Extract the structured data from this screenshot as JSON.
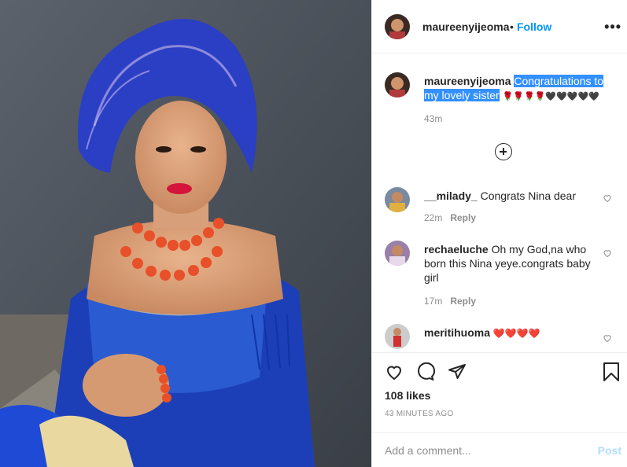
{
  "post": {
    "username": "maureenyijeoma",
    "follow_label": "Follow",
    "separator": "•",
    "more_icon": "more-horizontal-icon"
  },
  "caption": {
    "username": "maureenyijeoma",
    "text_line1": "Congratulations to",
    "text_line2": "my lovely sister",
    "emojis": "🌹🌹🌹🌹🖤🖤🖤🖤🖤",
    "time": "43m"
  },
  "comments": [
    {
      "username": "__milady_",
      "text": "Congrats Nina dear",
      "time": "22m",
      "reply": "Reply"
    },
    {
      "username": "rechaeluche",
      "text": "Oh my God,na who born this Nina yeye.congrats baby girl",
      "time": "17m",
      "reply": "Reply"
    },
    {
      "username": "meritihuoma",
      "text": "❤️❤️❤️❤️",
      "time": "",
      "reply": ""
    }
  ],
  "likes": "108 likes",
  "posted_ago": "43 MINUTES AGO",
  "add_comment": {
    "placeholder": "Add a comment...",
    "post_label": "Post"
  },
  "colors": {
    "link": "#0095f6",
    "muted": "#8e8e8e",
    "selection": "#3390ff",
    "post_disabled": "#b2dffc"
  }
}
